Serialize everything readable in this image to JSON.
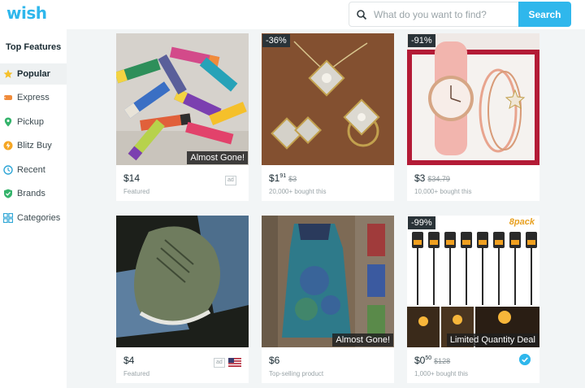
{
  "header": {
    "logo": "wish",
    "search_placeholder": "What do you want to find?",
    "search_button": "Search"
  },
  "sidebar": {
    "title": "Top Features",
    "items": [
      {
        "label": "Popular",
        "icon": "star-icon",
        "active": true
      },
      {
        "label": "Express",
        "icon": "express-icon"
      },
      {
        "label": "Pickup",
        "icon": "location-pin-icon"
      },
      {
        "label": "Blitz Buy",
        "icon": "blitz-buy-icon"
      },
      {
        "label": "Recent",
        "icon": "clock-icon"
      },
      {
        "label": "Brands",
        "icon": "shield-check-icon"
      },
      {
        "label": "Categories",
        "icon": "grid-icon"
      }
    ]
  },
  "products": [
    {
      "price": "$14",
      "subtitle": "Featured",
      "badge": "Almost Gone!",
      "ad": "ad"
    },
    {
      "discount": "-36%",
      "price_main": "$1",
      "price_cents": "91",
      "original": "$3",
      "subtitle": "20,000+ bought this"
    },
    {
      "discount": "-91%",
      "price": "$3",
      "original": "$34.79",
      "subtitle": "10,000+ bought this"
    },
    {
      "price": "$4",
      "subtitle": "Featured",
      "ad": "ad",
      "flag": "us-flag-icon"
    },
    {
      "price": "$6",
      "subtitle": "Top-selling product",
      "badge": "Almost Gone!"
    },
    {
      "discount": "-99%",
      "price_main": "$0",
      "price_cents": "50",
      "original": "$128",
      "subtitle": "1,000+ bought this",
      "badge": "Limited Quantity Deal",
      "pack_text": "8pack",
      "verified": "verified-check-icon"
    }
  ],
  "colors": {
    "brand": "#2fb7ec",
    "background": "#f2f5f6",
    "text": "#192a32",
    "muted": "#9aa4a8"
  }
}
